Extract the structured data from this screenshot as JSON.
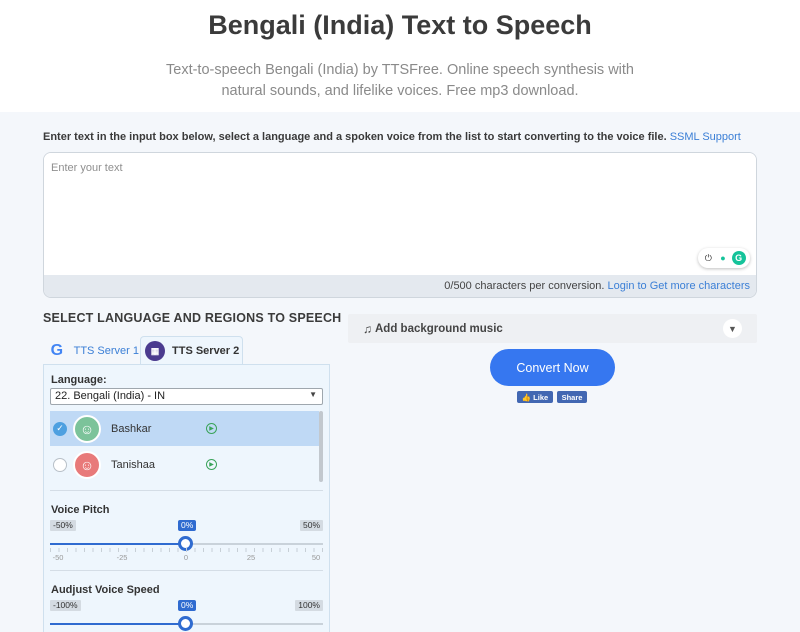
{
  "header": {
    "title": "Bengali (India) Text to Speech",
    "subtitle": "Text-to-speech Bengali (India) by TTSFree. Online speech synthesis with natural sounds, and lifelike voices. Free mp3 download."
  },
  "instructions": {
    "text": "Enter text in the input box below, select a language and a spoken voice from the list to start converting to the voice file.",
    "ssml_link": "SSML Support"
  },
  "input": {
    "placeholder": "Enter your text",
    "value": "",
    "counter": "0/500 characters per conversion.",
    "login_link": "Login to Get more characters"
  },
  "language_section": {
    "title": "SELECT LANGUAGE AND REGIONS TO SPEECH",
    "tabs": [
      {
        "label": "TTS Server 1",
        "icon": "google-icon",
        "active": false
      },
      {
        "label": "TTS Server 2",
        "icon": "tts-server-icon",
        "active": true
      }
    ],
    "language_label": "Language:",
    "selected_language": "22. Bengali (India) - IN",
    "voices": [
      {
        "name": "Bashkar",
        "selected": true,
        "avatar": "male-avatar-icon"
      },
      {
        "name": "Tanishaa",
        "selected": false,
        "avatar": "female-avatar-icon"
      }
    ]
  },
  "pitch": {
    "title": "Voice Pitch",
    "min_label": "-50%",
    "max_label": "50%",
    "value_label": "0%",
    "value": 0,
    "range": [
      -50,
      50
    ],
    "ticks": [
      "-50",
      "-25",
      "0",
      "25",
      "50"
    ]
  },
  "speed": {
    "title": "Audjust Voice Speed",
    "min_label": "-100%",
    "max_label": "100%",
    "value_label": "0%",
    "value": 0,
    "range": [
      -100,
      100
    ]
  },
  "bg_music": {
    "label": "Add background music",
    "icon": "music-note-icon"
  },
  "convert_button": "Convert Now",
  "social": {
    "like": "Like",
    "share": "Share"
  },
  "colors": {
    "accent": "#3677f0",
    "link": "#3b7fd6",
    "selected_voice_bg": "#bfd9f5"
  }
}
